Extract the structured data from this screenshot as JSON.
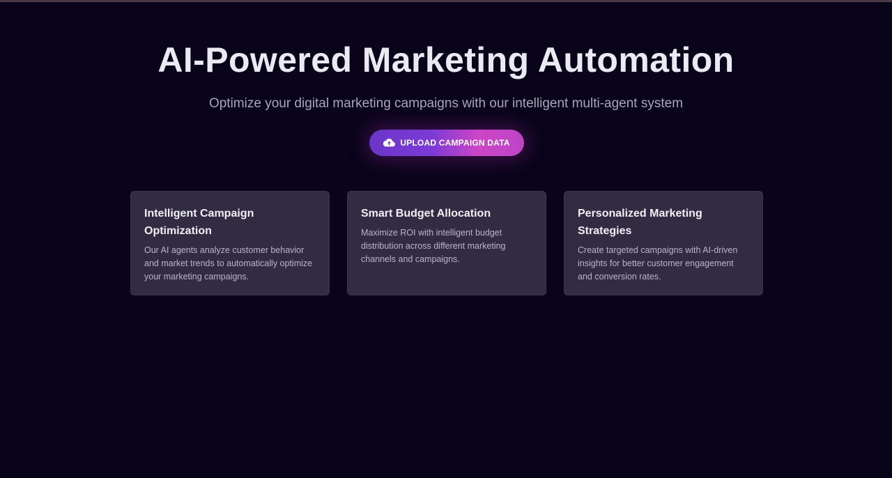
{
  "hero": {
    "title": "AI-Powered Marketing Automation",
    "subtitle": "Optimize your digital marketing campaigns with our intelligent multi-agent system",
    "upload_button": {
      "label": "UPLOAD CAMPAIGN DATA",
      "icon": "cloud-upload-icon"
    }
  },
  "features": [
    {
      "title": "Intelligent Campaign Optimization",
      "description": "Our AI agents analyze customer behavior and market trends to automatically optimize your marketing campaigns."
    },
    {
      "title": "Smart Budget Allocation",
      "description": "Maximize ROI with intelligent budget distribution across different marketing channels and campaigns."
    },
    {
      "title": "Personalized Marketing Strategies",
      "description": "Create targeted campaigns with AI-driven insights for better customer engagement and conversion rates."
    }
  ],
  "colors": {
    "background": "#09041a",
    "card": "#322c42",
    "accent_start": "#6a36c8",
    "accent_end": "#cc45c6"
  }
}
